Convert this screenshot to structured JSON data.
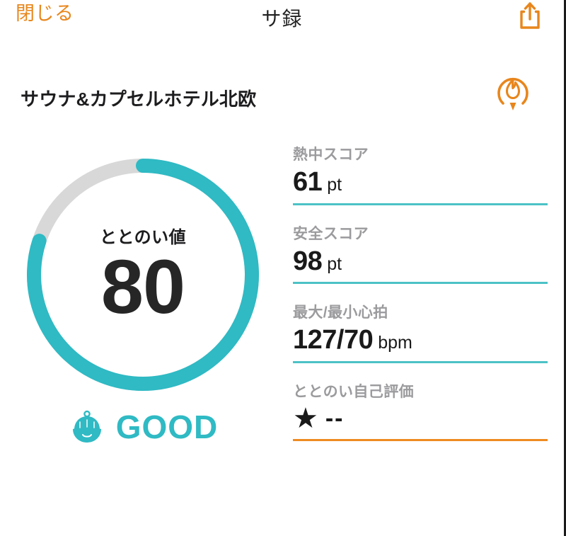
{
  "header": {
    "close_label": "閉じる",
    "title": "サ録",
    "share_icon": "share-icon",
    "accent_orange": "#e8861c"
  },
  "venue": {
    "name": "サウナ&カプセルホテル北欧",
    "badge_icon": "sauna-flame-icon",
    "badge_color": "#e8861c"
  },
  "gauge": {
    "label": "ととのい値",
    "value": "80",
    "percent": 80,
    "arc_color": "#2fbac4",
    "track_color": "#d8d8d8",
    "verdict_text": "GOOD",
    "verdict_icon": "sauna-hat-mascot-icon",
    "verdict_color": "#2fbac4"
  },
  "stats": [
    {
      "label": "熱中スコア",
      "value": "61",
      "unit": "pt",
      "rule_color": "#4cc2c6"
    },
    {
      "label": "安全スコア",
      "value": "98",
      "unit": "pt",
      "rule_color": "#4cc2c6"
    },
    {
      "label": "最大/最小心拍",
      "value": "127/70",
      "unit": "bpm",
      "rule_color": "#4cc2c6"
    },
    {
      "label": "ととのい自己評価",
      "value": "--",
      "unit": "",
      "star_icon": "star-icon",
      "rule_color": "#ee8b22"
    }
  ]
}
